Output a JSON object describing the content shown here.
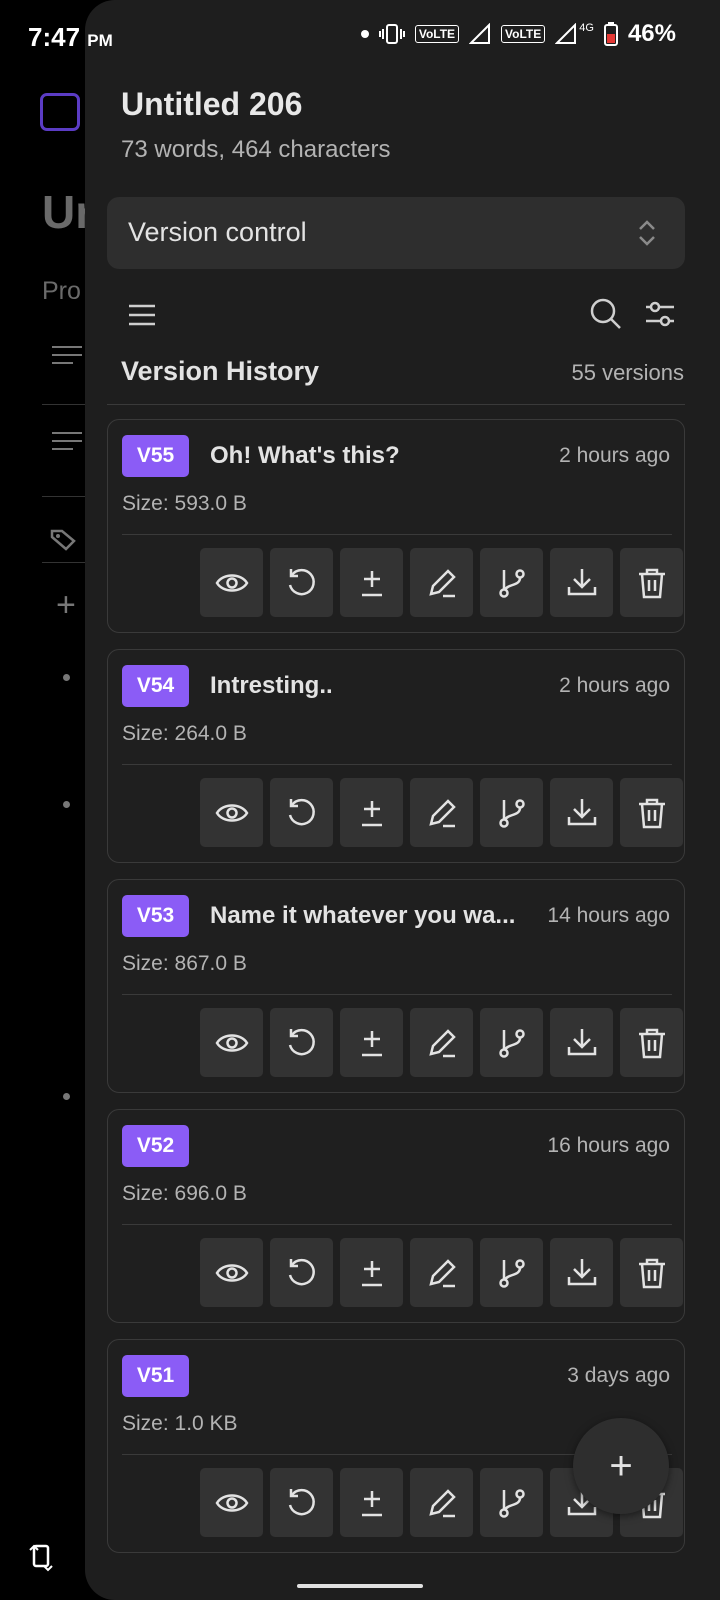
{
  "status_bar": {
    "time": "7:47",
    "ampm": "PM",
    "volte1": "VoLTE",
    "volte2": "VoLTE",
    "network": "4G",
    "battery": "46%"
  },
  "background": {
    "title_fragment": "Ur",
    "subtitle_fragment": "Pro"
  },
  "document": {
    "title": "Untitled 206",
    "meta": "73 words, 464 characters"
  },
  "view_select": {
    "value": "Version control"
  },
  "history": {
    "title": "Version History",
    "count": "55 versions"
  },
  "versions": [
    {
      "badge": "V55",
      "name": "Oh! What's this?",
      "time": "2 hours ago",
      "size": "Size: 593.0 B"
    },
    {
      "badge": "V54",
      "name": "Intresting..",
      "time": "2 hours ago",
      "size": "Size: 264.0 B"
    },
    {
      "badge": "V53",
      "name": "Name it whatever you wa...",
      "time": "14 hours ago",
      "size": "Size: 867.0 B"
    },
    {
      "badge": "V52",
      "name": "",
      "time": "16 hours ago",
      "size": "Size: 696.0 B"
    },
    {
      "badge": "V51",
      "name": "",
      "time": "3 days ago",
      "size": "Size: 1.0 KB"
    }
  ],
  "actions": [
    "view-icon",
    "restore-icon",
    "diff-icon",
    "rename-icon",
    "branch-icon",
    "download-icon",
    "delete-icon"
  ],
  "fab": {
    "icon": "plus-icon",
    "glyph": "+"
  },
  "colors": {
    "accent": "#8b5cf6",
    "panel": "#1e1e1e",
    "button": "#333333"
  }
}
